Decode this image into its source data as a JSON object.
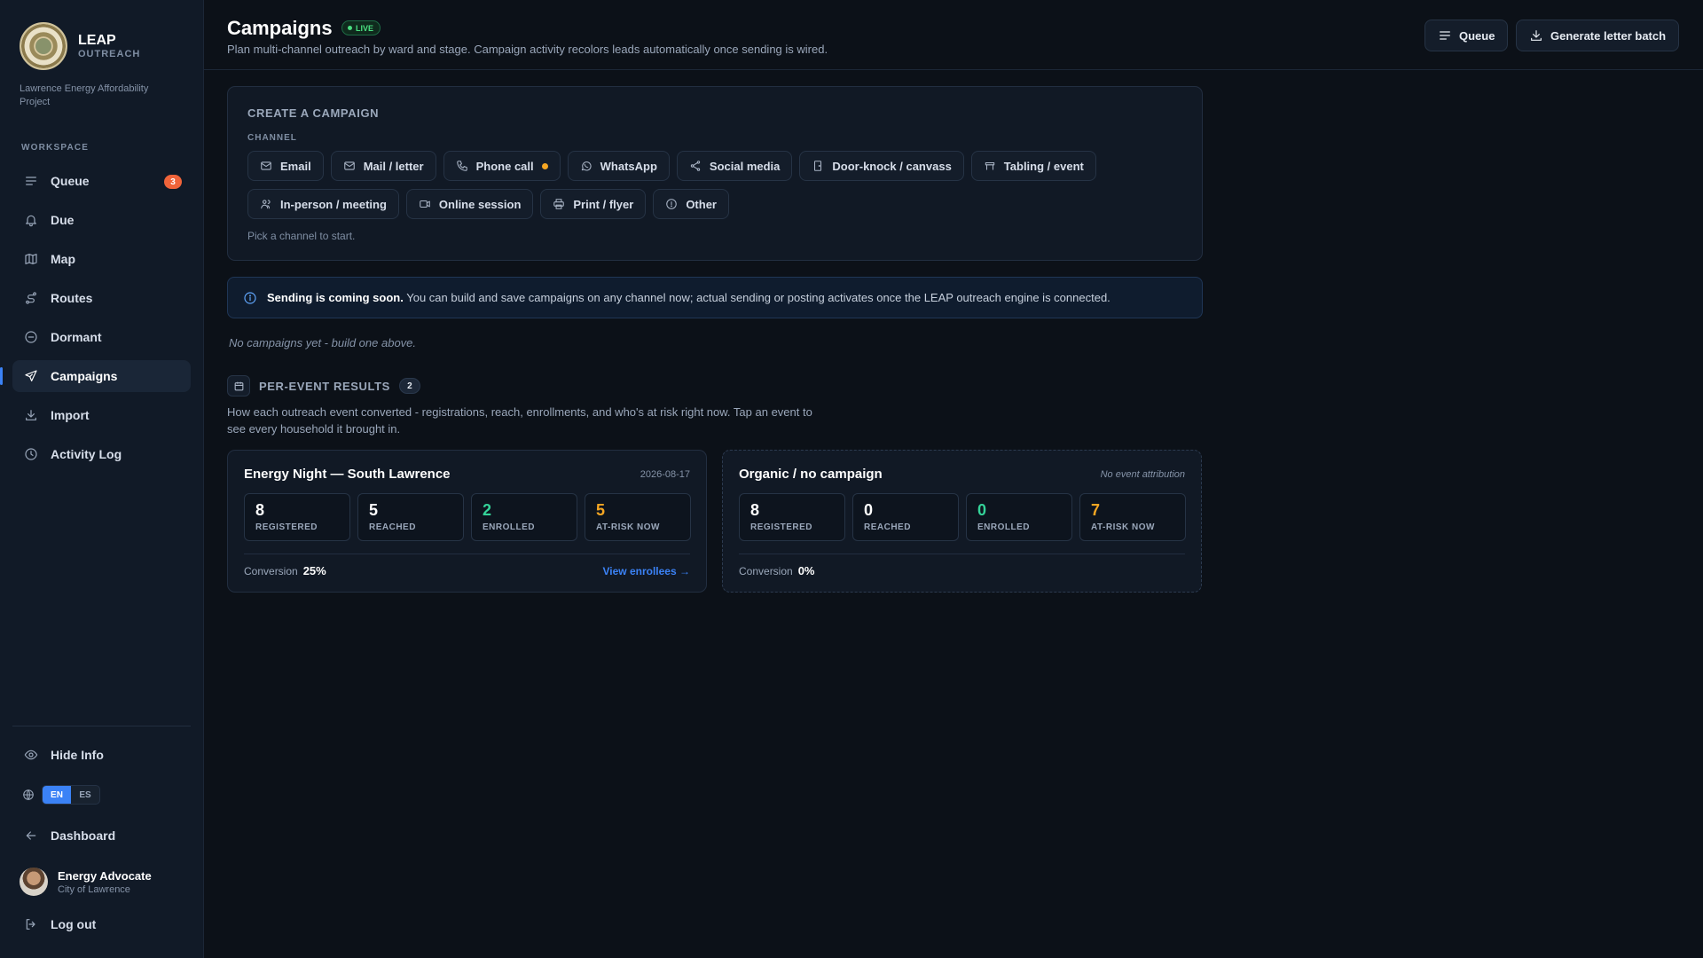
{
  "sidebar": {
    "brand_name": "LEAP",
    "brand_sub": "OUTREACH",
    "brand_desc": "Lawrence Energy Affordability Project",
    "section_label": "WORKSPACE",
    "nav": [
      {
        "label": "Queue",
        "icon": "list-icon",
        "badge": "3"
      },
      {
        "label": "Due",
        "icon": "bell-icon"
      },
      {
        "label": "Map",
        "icon": "map-icon"
      },
      {
        "label": "Routes",
        "icon": "route-icon"
      },
      {
        "label": "Dormant",
        "icon": "minus-circle-icon"
      },
      {
        "label": "Campaigns",
        "icon": "send-icon",
        "active": true
      },
      {
        "label": "Import",
        "icon": "download-icon"
      },
      {
        "label": "Activity Log",
        "icon": "clock-icon"
      }
    ],
    "hide_info": "Hide Info",
    "lang_en": "EN",
    "lang_es": "ES",
    "dashboard": "Dashboard",
    "user_name": "Energy Advocate",
    "user_org": "City of Lawrence",
    "logout": "Log out"
  },
  "header": {
    "title": "Campaigns",
    "live": "LIVE",
    "subtitle": "Plan multi-channel outreach by ward and stage. Campaign activity recolors leads automatically once sending is wired.",
    "queue_btn": "Queue",
    "generate_btn": "Generate letter batch"
  },
  "create": {
    "title": "CREATE A CAMPAIGN",
    "channel_label": "CHANNEL",
    "channels": [
      {
        "label": "Email",
        "icon": "mail-icon"
      },
      {
        "label": "Mail / letter",
        "icon": "letter-icon"
      },
      {
        "label": "Phone call",
        "icon": "phone-icon",
        "dot": true
      },
      {
        "label": "WhatsApp",
        "icon": "whatsapp-icon"
      },
      {
        "label": "Social media",
        "icon": "share-icon"
      },
      {
        "label": "Door-knock / canvass",
        "icon": "door-icon"
      },
      {
        "label": "Tabling / event",
        "icon": "table-icon"
      },
      {
        "label": "In-person / meeting",
        "icon": "users-icon"
      },
      {
        "label": "Online session",
        "icon": "video-icon"
      },
      {
        "label": "Print / flyer",
        "icon": "printer-icon"
      },
      {
        "label": "Other",
        "icon": "circle-icon"
      }
    ],
    "hint": "Pick a channel to start."
  },
  "notice": {
    "bold": "Sending is coming soon.",
    "text": "You can build and save campaigns on any channel now; actual sending or posting activates once the LEAP outreach engine is connected."
  },
  "empty_text": "No campaigns yet - build one above.",
  "per_event": {
    "title": "PER-EVENT RESULTS",
    "count": "2",
    "desc": "How each outreach event converted - registrations, reach, enrollments, and who's at risk right now. Tap an event to see every household it brought in.",
    "events": [
      {
        "title": "Energy Night — South Lawrence",
        "meta": "2026-08-17",
        "stats": [
          {
            "value": "8",
            "label": "REGISTERED"
          },
          {
            "value": "5",
            "label": "REACHED"
          },
          {
            "value": "2",
            "label": "ENROLLED"
          },
          {
            "value": "5",
            "label": "AT-RISK NOW"
          }
        ],
        "conversion_label": "Conversion",
        "conversion": "25%",
        "link": "View enrollees →"
      },
      {
        "title": "Organic / no campaign",
        "meta": "No event attribution",
        "stats": [
          {
            "value": "8",
            "label": "REGISTERED"
          },
          {
            "value": "0",
            "label": "REACHED"
          },
          {
            "value": "0",
            "label": "ENROLLED"
          },
          {
            "value": "7",
            "label": "AT-RISK NOW"
          }
        ],
        "conversion_label": "Conversion",
        "conversion": "0%"
      }
    ]
  },
  "colors": {
    "accent": "#3b82f6",
    "live": "#4ade80",
    "enrolled": "#34d399",
    "at_risk": "#f5a623",
    "badge": "#f0643a"
  }
}
